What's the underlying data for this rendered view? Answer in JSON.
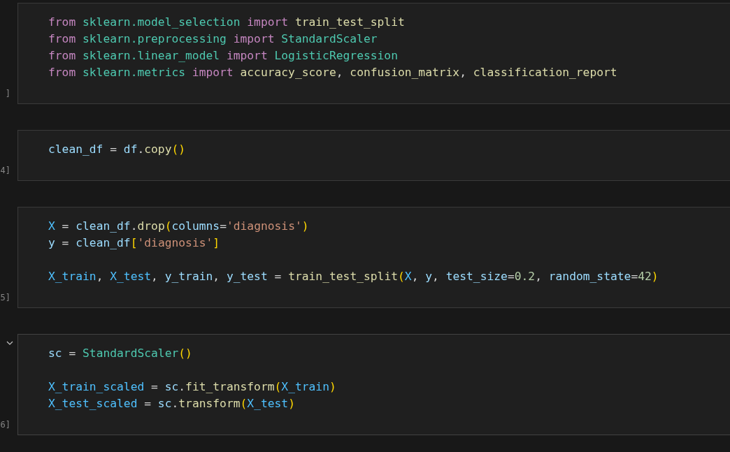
{
  "cells": [
    {
      "execution_count": "]",
      "focused": false,
      "lines": [
        {
          "kind": "code",
          "tokens": [
            {
              "keyword": "from "
            },
            {
              "module": "sklearn.model_selection "
            },
            {
              "keyword": "import "
            },
            {
              "function": "train_test_split"
            }
          ]
        },
        {
          "kind": "code",
          "tokens": [
            {
              "keyword": "from "
            },
            {
              "module": "sklearn.preprocessing "
            },
            {
              "keyword": "import "
            },
            {
              "module": "StandardScaler"
            }
          ]
        },
        {
          "kind": "code",
          "tokens": [
            {
              "keyword": "from "
            },
            {
              "module": "sklearn.linear_model "
            },
            {
              "keyword": "import "
            },
            {
              "module": "LogisticRegression"
            }
          ]
        },
        {
          "kind": "code",
          "tokens": [
            {
              "keyword": "from "
            },
            {
              "module": "sklearn.metrics "
            },
            {
              "keyword": "import "
            },
            {
              "function": "accuracy_score"
            },
            {
              "plain": ", "
            },
            {
              "function": "confusion_matrix"
            },
            {
              "plain": ", "
            },
            {
              "function": "classification_report"
            }
          ]
        }
      ]
    },
    {
      "execution_count": "4]",
      "focused": false,
      "lines": [
        {
          "kind": "code",
          "tokens": [
            {
              "variable": "clean_df"
            },
            {
              "plain": " = "
            },
            {
              "variable": "df"
            },
            {
              "plain": "."
            },
            {
              "function": "copy"
            },
            {
              "bracket": "()"
            }
          ]
        }
      ]
    },
    {
      "execution_count": "5]",
      "focused": false,
      "lines": [
        {
          "kind": "code",
          "tokens": [
            {
              "constant": "X"
            },
            {
              "plain": " = "
            },
            {
              "variable": "clean_df"
            },
            {
              "plain": "."
            },
            {
              "function": "drop"
            },
            {
              "bracket": "("
            },
            {
              "variable": "columns"
            },
            {
              "plain": "="
            },
            {
              "string": "'diagnosis'"
            },
            {
              "bracket": ")"
            }
          ]
        },
        {
          "kind": "code",
          "tokens": [
            {
              "variable": "y"
            },
            {
              "plain": " = "
            },
            {
              "variable": "clean_df"
            },
            {
              "bracket": "["
            },
            {
              "string": "'diagnosis'"
            },
            {
              "bracket": "]"
            }
          ]
        },
        {
          "kind": "blank"
        },
        {
          "kind": "code",
          "tokens": [
            {
              "constant": "X_train"
            },
            {
              "plain": ", "
            },
            {
              "constant": "X_test"
            },
            {
              "plain": ", "
            },
            {
              "variable": "y_train"
            },
            {
              "plain": ", "
            },
            {
              "variable": "y_test"
            },
            {
              "plain": " = "
            },
            {
              "function": "train_test_split"
            },
            {
              "bracket": "("
            },
            {
              "constant": "X"
            },
            {
              "plain": ", "
            },
            {
              "variable": "y"
            },
            {
              "plain": ", "
            },
            {
              "variable": "test_size"
            },
            {
              "plain": "="
            },
            {
              "number": "0.2"
            },
            {
              "plain": ", "
            },
            {
              "variable": "random_state"
            },
            {
              "plain": "="
            },
            {
              "number": "42"
            },
            {
              "bracket": ")"
            }
          ]
        }
      ]
    },
    {
      "execution_count": "6]",
      "focused": true,
      "lines": [
        {
          "kind": "code",
          "tokens": [
            {
              "variable": "sc"
            },
            {
              "plain": " = "
            },
            {
              "module": "StandardScaler"
            },
            {
              "bracket": "()"
            }
          ]
        },
        {
          "kind": "blank"
        },
        {
          "kind": "code",
          "tokens": [
            {
              "constant": "X_train_scaled"
            },
            {
              "plain": " = "
            },
            {
              "variable": "sc"
            },
            {
              "plain": "."
            },
            {
              "function": "fit_transform"
            },
            {
              "bracket": "("
            },
            {
              "constant": "X_train"
            },
            {
              "bracket": ")"
            }
          ]
        },
        {
          "kind": "code",
          "tokens": [
            {
              "constant": "X_test_scaled"
            },
            {
              "plain": " = "
            },
            {
              "variable": "sc"
            },
            {
              "plain": "."
            },
            {
              "function": "transform"
            },
            {
              "bracket": "("
            },
            {
              "constant": "X_test"
            },
            {
              "bracket": ")"
            }
          ]
        }
      ]
    }
  ]
}
